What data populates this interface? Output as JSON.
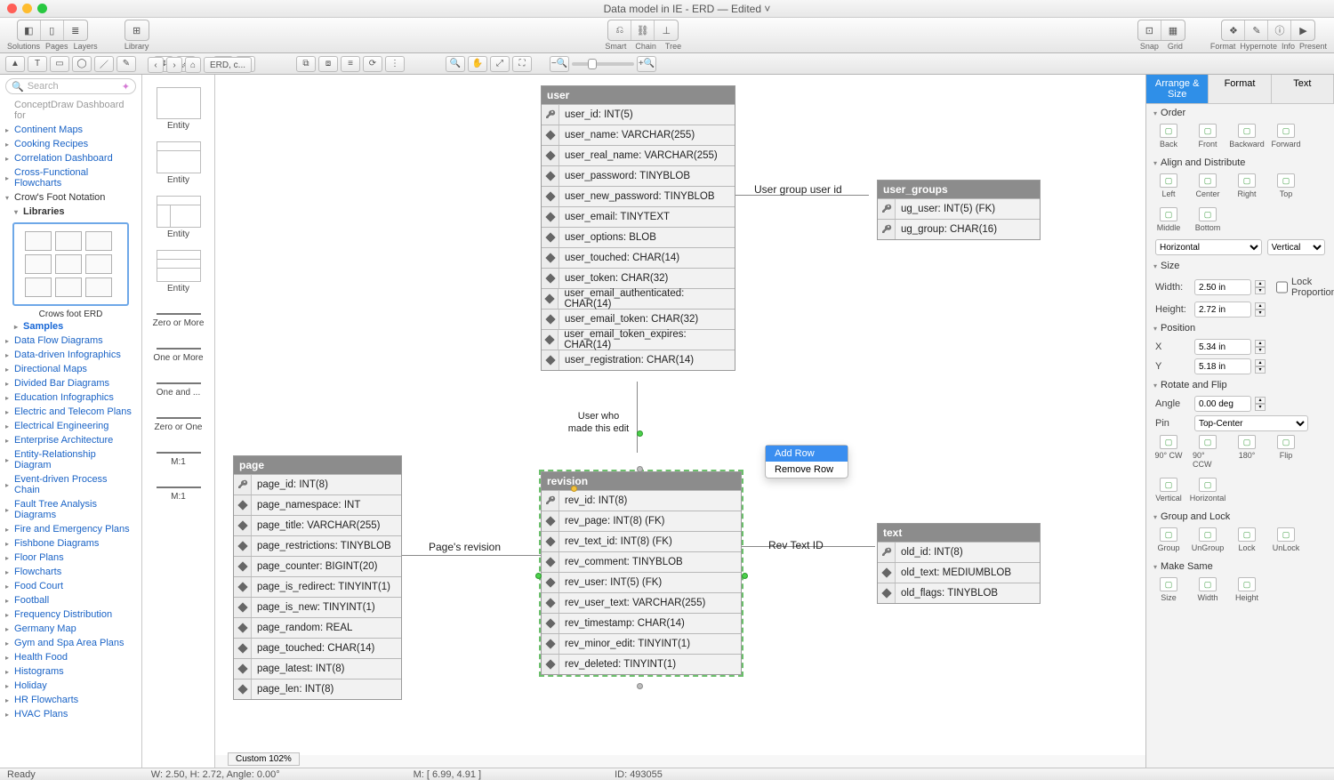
{
  "window": {
    "title": "Data model in IE - ERD — Edited ˅"
  },
  "toolbar": {
    "left": [
      {
        "label": "Solutions"
      },
      {
        "label": "Pages"
      },
      {
        "label": "Layers"
      }
    ],
    "library": {
      "label": "Library"
    },
    "center": [
      {
        "label": "Smart"
      },
      {
        "label": "Chain"
      },
      {
        "label": "Tree"
      }
    ],
    "right": [
      {
        "label": "Snap"
      },
      {
        "label": "Grid"
      },
      {
        "label": "Format"
      },
      {
        "label": "Hypernote"
      },
      {
        "label": "Info"
      },
      {
        "label": "Present"
      }
    ]
  },
  "search_placeholder": "Search",
  "tree": {
    "top_trunc": "ConceptDraw Dashboard for",
    "groups": [
      "Continent Maps",
      "Cooking Recipes",
      "Correlation Dashboard",
      "Cross-Functional Flowcharts"
    ],
    "open_group": "Crow's Foot Notation",
    "libraries": "Libraries",
    "thumb_caption": "Crows foot ERD",
    "samples": "Samples",
    "rest": [
      "Data Flow Diagrams",
      "Data-driven Infographics",
      "Directional Maps",
      "Divided Bar Diagrams",
      "Education Infographics",
      "Electric and Telecom Plans",
      "Electrical Engineering",
      "Enterprise Architecture",
      "Entity-Relationship Diagram",
      "Event-driven Process Chain",
      "Fault Tree Analysis Diagrams",
      "Fire and Emergency Plans",
      "Fishbone Diagrams",
      "Floor Plans",
      "Flowcharts",
      "Food Court",
      "Football",
      "Frequency Distribution",
      "Germany Map",
      "Gym and Spa Area Plans",
      "Health Food",
      "Histograms",
      "Holiday",
      "HR Flowcharts",
      "HVAC Plans"
    ]
  },
  "shapes": [
    {
      "label": "Entity"
    },
    {
      "label": "Entity"
    },
    {
      "label": "Entity"
    },
    {
      "label": "Entity"
    },
    {
      "label": "Zero or More"
    },
    {
      "label": "One or More"
    },
    {
      "label": "One and  ..."
    },
    {
      "label": "Zero or One"
    },
    {
      "label": "M:1"
    },
    {
      "label": "M:1"
    }
  ],
  "breadcrumb": {
    "home": "⌂",
    "page": "ERD, c..."
  },
  "tables": {
    "user": {
      "title": "user",
      "rows": [
        {
          "k": true,
          "t": "user_id: INT(5)"
        },
        {
          "k": false,
          "t": "user_name: VARCHAR(255)"
        },
        {
          "k": false,
          "t": "user_real_name: VARCHAR(255)"
        },
        {
          "k": false,
          "t": "user_password: TINYBLOB"
        },
        {
          "k": false,
          "t": "user_new_password: TINYBLOB"
        },
        {
          "k": false,
          "t": "user_email: TINYTEXT"
        },
        {
          "k": false,
          "t": "user_options: BLOB"
        },
        {
          "k": false,
          "t": "user_touched: CHAR(14)"
        },
        {
          "k": false,
          "t": "user_token: CHAR(32)"
        },
        {
          "k": false,
          "t": "user_email_authenticated: CHAR(14)"
        },
        {
          "k": false,
          "t": "user_email_token: CHAR(32)"
        },
        {
          "k": false,
          "t": "user_email_token_expires: CHAR(14)"
        },
        {
          "k": false,
          "t": "user_registration: CHAR(14)"
        }
      ]
    },
    "user_groups": {
      "title": "user_groups",
      "rows": [
        {
          "k": true,
          "t": "ug_user: INT(5) (FK)"
        },
        {
          "k": true,
          "t": "ug_group: CHAR(16)"
        }
      ]
    },
    "page": {
      "title": "page",
      "rows": [
        {
          "k": true,
          "t": "page_id: INT(8)"
        },
        {
          "k": false,
          "t": "page_namespace: INT"
        },
        {
          "k": false,
          "t": "page_title: VARCHAR(255)"
        },
        {
          "k": false,
          "t": "page_restrictions: TINYBLOB"
        },
        {
          "k": false,
          "t": "page_counter: BIGINT(20)"
        },
        {
          "k": false,
          "t": "page_is_redirect: TINYINT(1)"
        },
        {
          "k": false,
          "t": "page_is_new: TINYINT(1)"
        },
        {
          "k": false,
          "t": "page_random: REAL"
        },
        {
          "k": false,
          "t": "page_touched: CHAR(14)"
        },
        {
          "k": false,
          "t": "page_latest: INT(8)"
        },
        {
          "k": false,
          "t": "page_len: INT(8)"
        }
      ]
    },
    "revision": {
      "title": "revision",
      "rows": [
        {
          "k": true,
          "t": "rev_id: INT(8)"
        },
        {
          "k": false,
          "t": "rev_page: INT(8) (FK)"
        },
        {
          "k": false,
          "t": "rev_text_id: INT(8) (FK)"
        },
        {
          "k": false,
          "t": "rev_comment: TINYBLOB"
        },
        {
          "k": false,
          "t": "rev_user: INT(5) (FK)"
        },
        {
          "k": false,
          "t": "rev_user_text: VARCHAR(255)"
        },
        {
          "k": false,
          "t": "rev_timestamp: CHAR(14)"
        },
        {
          "k": false,
          "t": "rev_minor_edit: TINYINT(1)"
        },
        {
          "k": false,
          "t": "rev_deleted: TINYINT(1)"
        }
      ]
    },
    "text": {
      "title": "text",
      "rows": [
        {
          "k": true,
          "t": "old_id: INT(8)"
        },
        {
          "k": false,
          "t": "old_text: MEDIUMBLOB"
        },
        {
          "k": false,
          "t": "old_flags: TINYBLOB"
        }
      ]
    }
  },
  "labels": {
    "l1": "User group user id",
    "l2_a": "User who",
    "l2_b": "made this edit",
    "l3": "Page's revision",
    "l4": "Rev Text ID"
  },
  "ctx": {
    "item1": "Add Row",
    "item2": "Remove Row"
  },
  "inspector": {
    "tabs": [
      "Arrange & Size",
      "Format",
      "Text"
    ],
    "order": {
      "h": "Order",
      "btns": [
        "Back",
        "Front",
        "Backward",
        "Forward"
      ]
    },
    "align": {
      "h": "Align and Distribute",
      "btns": [
        "Left",
        "Center",
        "Right",
        "Top",
        "Middle",
        "Bottom"
      ],
      "sel1": "Horizontal",
      "sel2": "Vertical"
    },
    "size": {
      "h": "Size",
      "width_l": "Width:",
      "width_v": "2.50 in",
      "height_l": "Height:",
      "height_v": "2.72 in",
      "lock": "Lock Proportions"
    },
    "pos": {
      "h": "Position",
      "x_l": "X",
      "x_v": "5.34 in",
      "y_l": "Y",
      "y_v": "5.18 in"
    },
    "rot": {
      "h": "Rotate and Flip",
      "ang_l": "Angle",
      "ang_v": "0.00 deg",
      "pin_l": "Pin",
      "pin_v": "Top-Center",
      "btns": [
        "90° CW",
        "90° CCW",
        "180°",
        "Flip",
        "Vertical",
        "Horizontal"
      ]
    },
    "grp": {
      "h": "Group and Lock",
      "btns": [
        "Group",
        "UnGroup",
        "Lock",
        "UnLock"
      ]
    },
    "same": {
      "h": "Make Same",
      "btns": [
        "Size",
        "Width",
        "Height"
      ]
    }
  },
  "status": {
    "ready": "Ready",
    "wh": "W: 2.50,  H: 2.72,  Angle: 0.00°",
    "mouse": "M: [ 6.99, 4.91 ]",
    "id": "ID: 493055",
    "zoom": "Custom 102%"
  }
}
